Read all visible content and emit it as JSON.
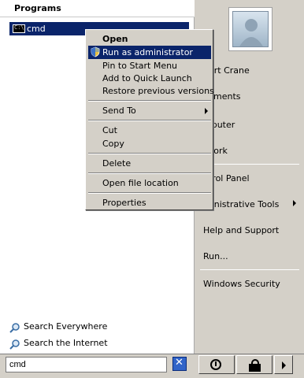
{
  "programs": {
    "header": "Programs",
    "items": [
      {
        "label": "cmd",
        "icon": "console-icon"
      }
    ]
  },
  "search_links": [
    {
      "label": "Search Everywhere",
      "icon": "magnifier-icon"
    },
    {
      "label": "Search the Internet",
      "icon": "magnifier-icon"
    }
  ],
  "right_panel": {
    "user_name": "bert Crane",
    "items": [
      {
        "label": "cuments"
      },
      {
        "label": "mputer"
      },
      {
        "label": "twork"
      },
      {
        "label": "ntrol Panel"
      },
      {
        "label": "ministrative Tools"
      },
      {
        "label": "Help and Support"
      },
      {
        "label": "Run..."
      },
      {
        "label": "Windows Security"
      }
    ]
  },
  "search_box": {
    "value": "cmd"
  },
  "context_menu": {
    "items": [
      {
        "label": "Open",
        "bold": true
      },
      {
        "label": "Run as administrator",
        "highlighted": true,
        "icon": "uac-shield-icon"
      },
      {
        "label": "Pin to Start Menu"
      },
      {
        "label": "Add to Quick Launch"
      },
      {
        "label": "Restore previous versions"
      },
      {
        "label": "Send To",
        "submenu": true
      },
      {
        "label": "Cut"
      },
      {
        "label": "Copy"
      },
      {
        "label": "Delete"
      },
      {
        "label": "Open file location"
      },
      {
        "label": "Properties"
      }
    ]
  },
  "colors": {
    "selection": "#0a246a",
    "panel": "#d4d0c8",
    "white": "#ffffff"
  }
}
